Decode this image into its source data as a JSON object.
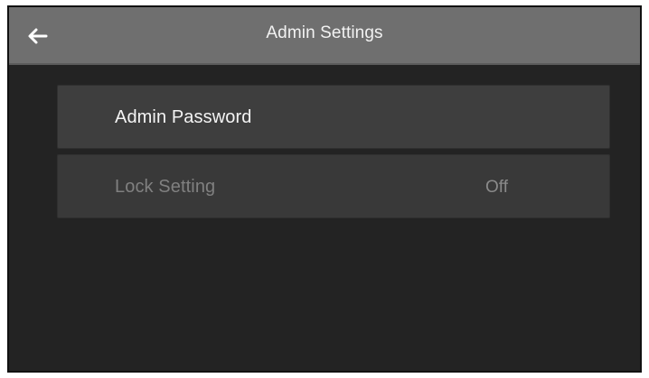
{
  "header": {
    "title": "Admin Settings",
    "back_icon": "arrow-left-icon"
  },
  "settings": {
    "items": [
      {
        "label": "Admin Password"
      },
      {
        "label": "Lock Setting",
        "value": "Off",
        "state": "disabled"
      }
    ]
  },
  "colors": {
    "header_background": "#6f6f6f",
    "screen_background": "#232323",
    "row_background": "#3e3e3e",
    "primary_text": "#f4f4f4",
    "secondary_text": "#8a8a8a"
  }
}
